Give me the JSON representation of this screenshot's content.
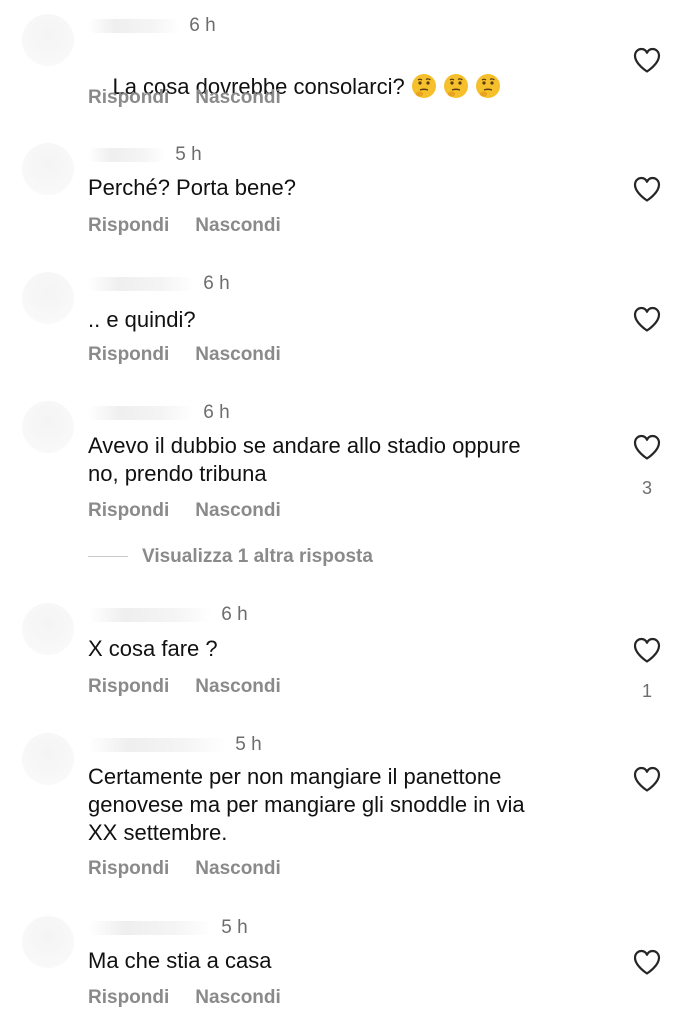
{
  "comments": [
    {
      "time": "6 h",
      "text": "La cosa dovrebbe consolarci?",
      "emojis": [
        "thinking-face-icon",
        "thinking-face-icon",
        "thinking-face-icon"
      ],
      "reply_label": "Rispondi",
      "hide_label": "Nascondi",
      "likes": ""
    },
    {
      "time": "5 h",
      "text": "Perché? Porta bene?",
      "reply_label": "Rispondi",
      "hide_label": "Nascondi",
      "likes": ""
    },
    {
      "time": "6 h",
      "text": ".. e quindi?",
      "reply_label": "Rispondi",
      "hide_label": "Nascondi",
      "likes": ""
    },
    {
      "time": "6 h",
      "text": "Avevo il dubbio se andare allo stadio oppure\nno, prendo tribuna",
      "reply_label": "Rispondi",
      "hide_label": "Nascondi",
      "likes": "3"
    },
    {
      "time": "6 h",
      "text": "X cosa fare ?",
      "reply_label": "Rispondi",
      "hide_label": "Nascondi",
      "likes": "1"
    },
    {
      "time": "5 h",
      "text": "Certamente per non mangiare il panettone\ngenovese ma per mangiare gli snoddle in via\nXX settembre.",
      "reply_label": "Rispondi",
      "hide_label": "Nascondi",
      "likes": ""
    },
    {
      "time": "5 h",
      "text": "Ma che stia a casa",
      "reply_label": "Rispondi",
      "hide_label": "Nascondi",
      "likes": ""
    }
  ],
  "view_more_replies": "Visualizza 1 altra risposta",
  "icons": {
    "like": "heart-outline-icon",
    "emoji": "thinking-face-icon"
  },
  "colors": {
    "text": "#111111",
    "secondary": "#6d6d6d",
    "action": "#8a8a8a",
    "emoji_face": "#f5c02c"
  }
}
